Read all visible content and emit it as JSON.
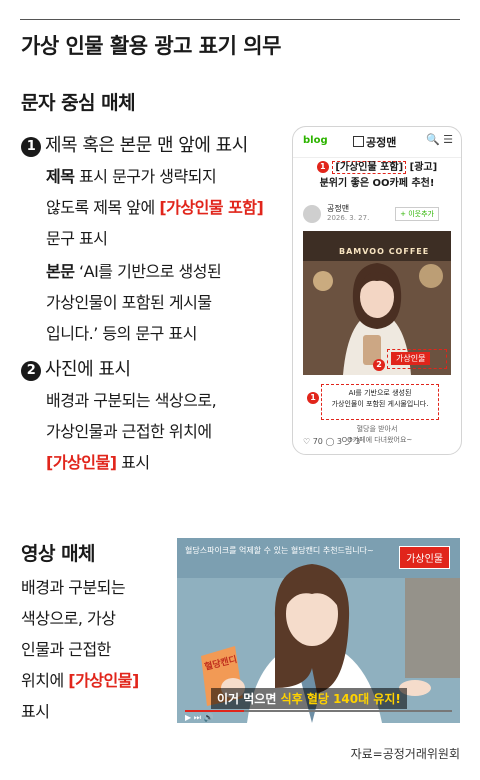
{
  "title": "가상 인물 활용 광고 표기 의무",
  "text_media": {
    "heading": "문자 중심 매체",
    "item1": {
      "number": "1",
      "label": "제목 혹은 본문 맨 앞에 표시",
      "p1": {
        "bold": "제목",
        "t1": " 표시 문구가 생략되지",
        "t2": "않도록 제목 앞에 ",
        "red": "[가상인물 포함]",
        "t3": "문구 표시"
      },
      "p2": {
        "bold": "본문",
        "t1": " ‘AI를 기반으로 생성된",
        "t2": "가상인물이 포함된 게시물",
        "t3": "입니다.’ 등의 문구 표시"
      }
    },
    "item2": {
      "number": "2",
      "label": "사진에 표시",
      "t1": "배경과 구분되는 색상으로,",
      "t2": "가상인물과 근접한 위치에",
      "red": "[가상인물]",
      "t3": " 표시"
    }
  },
  "phone": {
    "app": "blog",
    "blog_name": "공정맨",
    "icons": "🔍 ☰",
    "headline_badge": "1",
    "headline_red": "[가상인물 포함]",
    "headline_tag": " [광고]",
    "headline_2": "분위기 좋은 OO카페 추천!",
    "author": "공정맨",
    "date": "2026. 3. 27.",
    "follow": "+ 이웃추가",
    "cafe_sign": "BAMVOO COFFEE",
    "photo_badge": "2",
    "photo_label": "가상인물",
    "notice_badge": "1",
    "notice_l1": "AI를 기반으로 생성된",
    "notice_l2": "가상인물이 포함된 게시물입니다.",
    "small_1": "혈당을 받아서",
    "small_2": "OO카페에 다녀왔어요~",
    "footer": "♡ 70   ◯ 3   ⤴ 3"
  },
  "video_media": {
    "heading": "영상 매체",
    "l1": "배경과 구분되는",
    "l2": "색상으로, 가상",
    "l3": "인물과 근접한",
    "l4a": "위치에 ",
    "l4red": "[가상인물]",
    "l5": "표시"
  },
  "video": {
    "top_caption": "혈당스파이크를 억제할 수 있는 혈당캔디 추천드립니다~",
    "label": "가상인물",
    "product": "혈당캔디",
    "subtitle_white": "이거 먹으면 ",
    "subtitle_yellow": "식후 혈당 140대 유지!",
    "controls": "▶ ⏭ 🔊"
  },
  "source": "자료=공정거래위원회",
  "colors": {
    "accent_red": "#e1251b",
    "text": "#1a1a1a",
    "blog_green": "#2db400",
    "subtitle_yellow": "#ffd200"
  }
}
